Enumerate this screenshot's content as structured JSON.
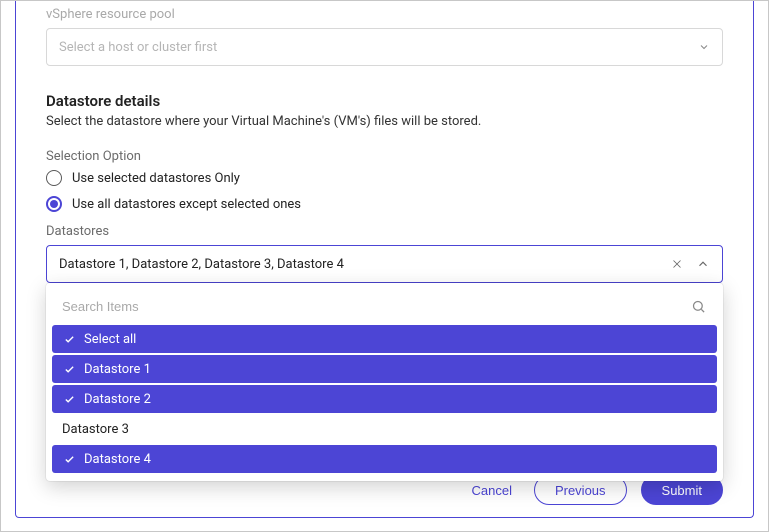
{
  "resourcePool": {
    "label": "vSphere resource pool",
    "placeholder": "Select a host or cluster first"
  },
  "datastoreDetails": {
    "title": "Datastore details",
    "description": "Select the datastore where your Virtual Machine's (VM's)  files will be stored."
  },
  "selectionOption": {
    "label": "Selection Option",
    "options": [
      {
        "label": "Use selected datastores Only",
        "checked": false
      },
      {
        "label": "Use all datastores except selected ones",
        "checked": true
      }
    ]
  },
  "datastores": {
    "label": "Datastores",
    "value": "Datastore 1, Datastore 2,  Datastore 3,  Datastore 4",
    "searchPlaceholder": "Search Items",
    "options": [
      {
        "label": "Select all",
        "selected": true
      },
      {
        "label": "Datastore 1",
        "selected": true
      },
      {
        "label": "Datastore 2",
        "selected": true
      },
      {
        "label": "Datastore 3",
        "selected": false
      },
      {
        "label": "Datastore 4",
        "selected": true
      }
    ]
  },
  "footer": {
    "cancel": "Cancel",
    "previous": "Previous",
    "submit": "Submit"
  }
}
